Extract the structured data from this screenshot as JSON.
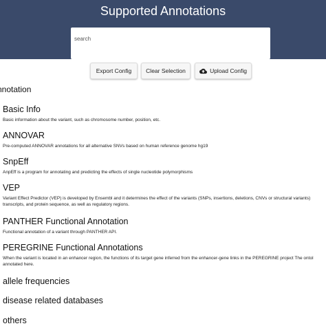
{
  "header": {
    "title": "Supported Annotations",
    "background_color": "#3a4a6a"
  },
  "search": {
    "placeholder": "search",
    "value": ""
  },
  "toolbar": {
    "export_label": "Export Config",
    "clear_label": "Clear Selection",
    "upload_label": "Upload Config",
    "upload_icon": "cloud-upload-icon"
  },
  "section": {
    "label": "nnotation"
  },
  "categories": [
    {
      "title": "Basic Info",
      "description": "Basic information about the variant, such as chromosome number, position, etc."
    },
    {
      "title": "ANNOVAR",
      "description": "Pre-computed ANNOVAR annotations for all alternative SNVs based on human reference genome hg19"
    },
    {
      "title": "SnpEff",
      "description": "AnpEff is a program for annotating and predicting the effects of single nucleotide polymorphisms"
    },
    {
      "title": "VEP",
      "description": "Variant Effect Predictor (VEP) is developed by Ensembl and it determines the effect of the variants (SNPs, insertions, deletions, CNVs or structural variants) transcripts, and protein sequence, as well as regulatory regions."
    },
    {
      "title": "PANTHER Functional Annotation",
      "description": "Functional annotation of a variant through PANTHER API."
    },
    {
      "title": "PEREGRINE Functional Annotations",
      "description": "When the variant is located in an enhancer region, the functions of its target gene inferred from the enhancer-gene links in the PEREGRINE project The ontol annotated here."
    },
    {
      "title": "allele frequencies",
      "description": ""
    },
    {
      "title": "disease related databases",
      "description": ""
    },
    {
      "title": "others",
      "description": ""
    }
  ]
}
